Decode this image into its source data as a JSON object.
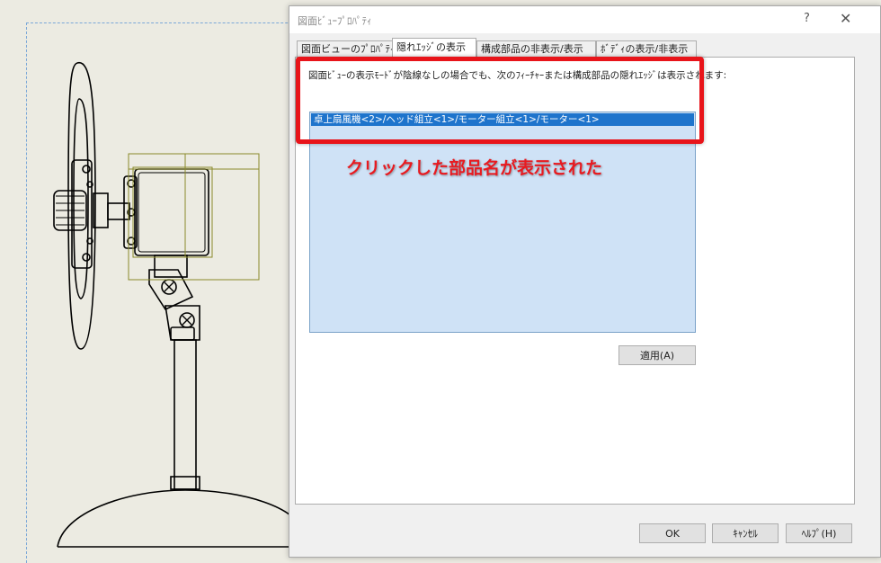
{
  "dialog": {
    "title": "図面ﾋﾞｭｰﾌﾟﾛﾊﾟﾃｨ",
    "help_glyph": "?",
    "close_glyph": "✕",
    "tabs": [
      {
        "label": "図面ビューのﾌﾟﾛﾊﾟﾃｨ",
        "active": false
      },
      {
        "label": "隠れｴｯｼﾞの表示",
        "active": true
      },
      {
        "label": "構成部品の非表示/表示",
        "active": false
      },
      {
        "label": "ﾎﾞﾃﾞｨの表示/非表示",
        "active": false
      }
    ],
    "description": "図面ﾋﾞｭｰの表示ﾓｰﾄﾞが陰線なしの場合でも、次のﾌｨｰﾁｬｰまたは構成部品の隠れｴｯｼﾞは表示されます:",
    "list_items": [
      "卓上扇風機<2>/ヘッド組立<1>/モーター組立<1>/モーター<1>"
    ],
    "apply_label": "適用(A)",
    "ok_label": "OK",
    "cancel_label": "ｷｬﾝｾﾙ",
    "help_label": "ﾍﾙﾌﾟ(H)"
  },
  "annotation": {
    "callout_text": "クリックした部品名が表示された",
    "color": "#e8141a"
  },
  "colors": {
    "background": "#ecebe2",
    "selection": "#1e74cc",
    "list_background": "#cfe2f6",
    "sketch_box": "#8a8a2a"
  }
}
